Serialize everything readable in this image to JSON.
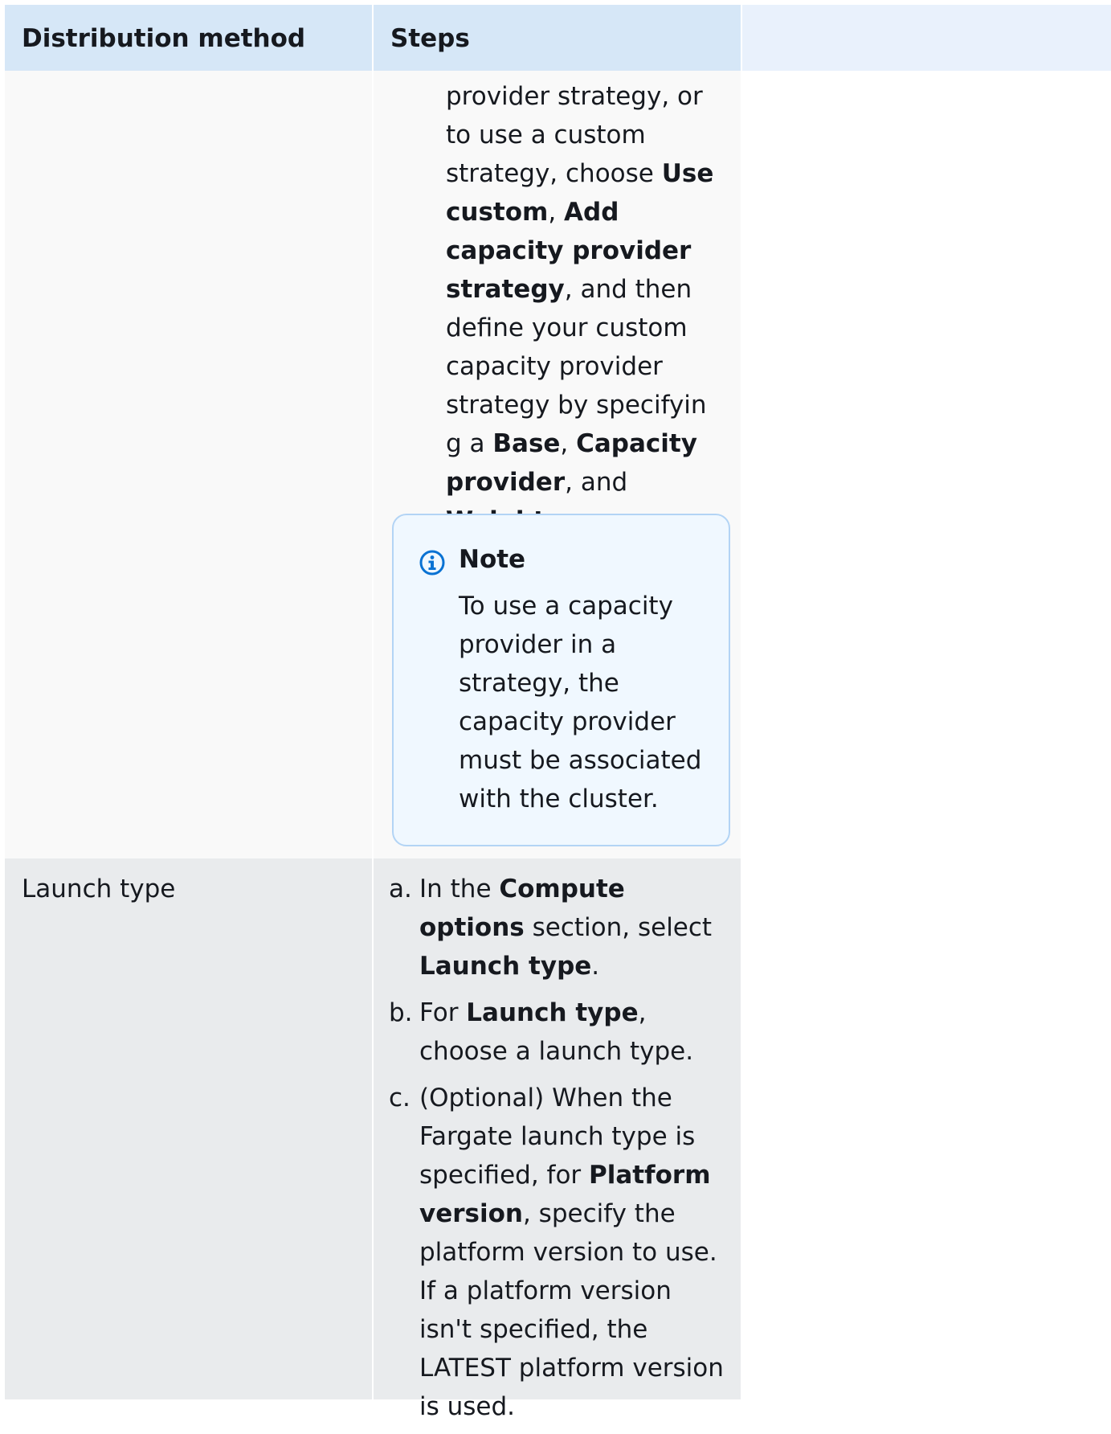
{
  "header": {
    "col1": "Distribution method",
    "col2": "Steps"
  },
  "row1": {
    "steps_fragments": [
      "provider strategy, or to use a custom strategy, choose ",
      "Use custom",
      ", ",
      "Add capacity provider strategy",
      ", and then define your custom capacity provider strategy by specifyin g a ",
      "Base",
      ", ",
      "Capacity provider",
      ", and ",
      "Weight",
      "."
    ],
    "note": {
      "icon": "info-icon",
      "title": "Note",
      "body": "To use a capacity provider in a strategy, the capacity provider must be associated with the cluster."
    }
  },
  "row2": {
    "method": "Launch type",
    "steps": [
      {
        "marker": "a.",
        "fragments": [
          "In the ",
          "Compute options",
          " section, select ",
          "Launch type",
          "."
        ]
      },
      {
        "marker": "b.",
        "fragments": [
          "For ",
          "Launch type",
          ", choose a launch type."
        ]
      },
      {
        "marker": "c.",
        "fragments": [
          "(Optional) When the Fargate launch type is specified, for ",
          "Platform version",
          ", specify the platform version to use. If a platform version isn't specified, the LATEST platform version is used."
        ]
      }
    ]
  },
  "colors": {
    "header_bg": "#d6e7f7",
    "note_border": "#b3d4f5",
    "info_icon": "#0972d3"
  }
}
